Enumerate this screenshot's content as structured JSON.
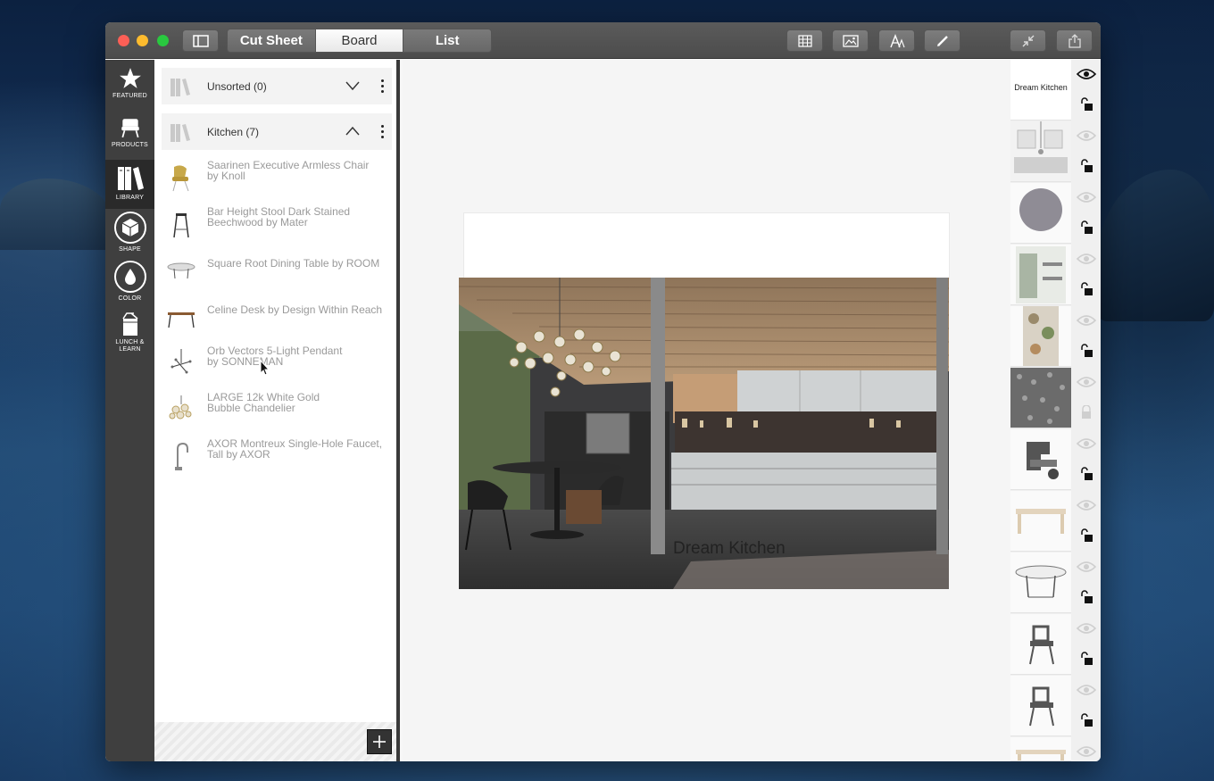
{
  "app": {
    "view_tabs": [
      {
        "label": "Cut Sheet",
        "active": false
      },
      {
        "label": "Board",
        "active": true
      },
      {
        "label": "List",
        "active": false
      }
    ],
    "toolbar_icons": [
      "sidebar-toggle-icon",
      "grid-icon",
      "image-icon",
      "text-icon",
      "pencil-icon",
      "collapse-icon",
      "share-icon"
    ]
  },
  "rail": {
    "items": [
      {
        "label": "FEATURED",
        "icon": "star-icon"
      },
      {
        "label": "PRODUCTS",
        "icon": "chair-icon"
      },
      {
        "label": "LIBRARY",
        "icon": "library-icon",
        "active": true
      },
      {
        "label": "SHAPE",
        "icon": "cube-icon"
      },
      {
        "label": "COLOR",
        "icon": "drop-icon"
      },
      {
        "label": "LUNCH & LEARN",
        "icon": "lunch-bag-icon"
      }
    ]
  },
  "library": {
    "groups": [
      {
        "label": "Unsorted (0)",
        "expanded": false
      },
      {
        "label": "Kitchen (7)",
        "expanded": true
      }
    ],
    "items": [
      {
        "line1": "Saarinen Executive Armless Chair",
        "line2": "by Knoll"
      },
      {
        "line1": "Bar Height Stool Dark Stained",
        "line2": "Beechwood by Mater"
      },
      {
        "line1": "Square Root Dining Table by ROOM",
        "line2": ""
      },
      {
        "line1": "Celine Desk by Design Within Reach",
        "line2": ""
      },
      {
        "line1": "Orb Vectors 5-Light Pendant",
        "line2": "by SONNEMAN"
      },
      {
        "line1": "LARGE 12k White Gold",
        "line2": "Bubble Chandelier"
      },
      {
        "line1": "AXOR Montreux Single-Hole Faucet,",
        "line2": "Tall by AXOR"
      }
    ]
  },
  "board": {
    "caption": "Dream Kitchen"
  },
  "layers": {
    "first_title": "Dream Kitchen"
  }
}
